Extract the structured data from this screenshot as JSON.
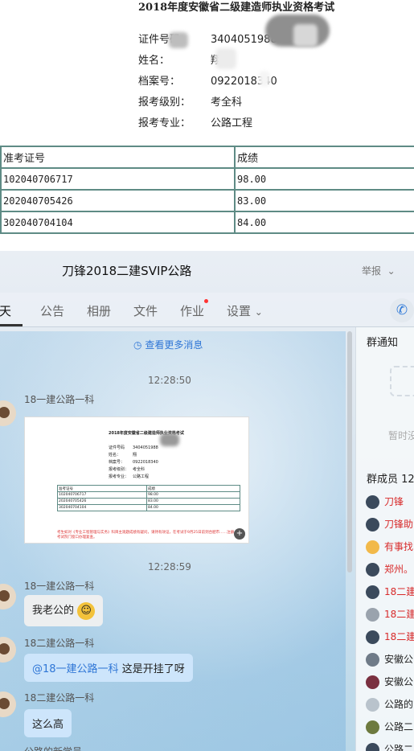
{
  "cert": {
    "title": "2018年度安徽省二级建造师执业资格考试",
    "rows": [
      {
        "label": "证件号码",
        "value": "3404051988"
      },
      {
        "label": "姓名：",
        "value": "翔"
      },
      {
        "label": "档案号：",
        "value": "0922018340"
      },
      {
        "label": "报考级别：",
        "value": "考全科"
      },
      {
        "label": "报考专业：",
        "value": "公路工程"
      }
    ],
    "table": {
      "headers": [
        "准考证号",
        "成绩"
      ],
      "rows": [
        [
          "102040706717",
          "98.00"
        ],
        [
          "202040705426",
          "83.00"
        ],
        [
          "302040704104",
          "84.00"
        ]
      ]
    }
  },
  "chat": {
    "group_name": "刀锋2018二建SVIP公路",
    "report_label": "举报",
    "tabs": [
      "聊天",
      "公告",
      "相册",
      "文件",
      "作业",
      "设置"
    ],
    "more_messages": "查看更多消息",
    "messages": [
      {
        "time": "12:28:50",
        "sender": "18一建公路一科",
        "type": "image"
      },
      {
        "time": "12:28:59",
        "sender": "18一建公路一科",
        "text": "我老公的"
      },
      {
        "sender": "18二建公路一科",
        "mention": "@18一建公路一科",
        "text": "这是开挂了呀"
      },
      {
        "sender": "18二建公路一科",
        "text": "这么高"
      },
      {
        "sender": "公路的新学员",
        "text": ""
      }
    ],
    "thumb": {
      "title": "2018年度安徽省二级建造师执业资格考试",
      "rows": [
        {
          "label": "证件号码",
          "value": "3404051988"
        },
        {
          "label": "姓名：",
          "value": "翔"
        },
        {
          "label": "档案号：",
          "value": "0922018340"
        },
        {
          "label": "报考级别：",
          "value": "考全科"
        },
        {
          "label": "报考专业：",
          "value": "公路工程"
        }
      ],
      "notice": "考生如对《专业工程管理与实务》科目主观题成绩有疑问，请持有效证，在考试于9月25日前到合肥市……注册人事考试院门窗口办理复查。"
    }
  },
  "panel": {
    "notice_title": "群通知",
    "empty_text": "暂时没",
    "members_title": "群成员 12",
    "members": [
      {
        "name": "刀锋",
        "color": "red"
      },
      {
        "name": "刀锋助",
        "color": "red"
      },
      {
        "name": "有事找",
        "color": "red"
      },
      {
        "name": "郑州。",
        "color": "red"
      },
      {
        "name": "18二建",
        "color": "red"
      },
      {
        "name": "18二建",
        "color": "red"
      },
      {
        "name": "18二建",
        "color": "red"
      },
      {
        "name": "安徽公",
        "color": "dark"
      },
      {
        "name": "安徽公",
        "color": "dark"
      },
      {
        "name": "公路的",
        "color": "dark"
      },
      {
        "name": "公路二",
        "color": "dark"
      },
      {
        "name": "公路二",
        "color": "dark"
      }
    ]
  }
}
